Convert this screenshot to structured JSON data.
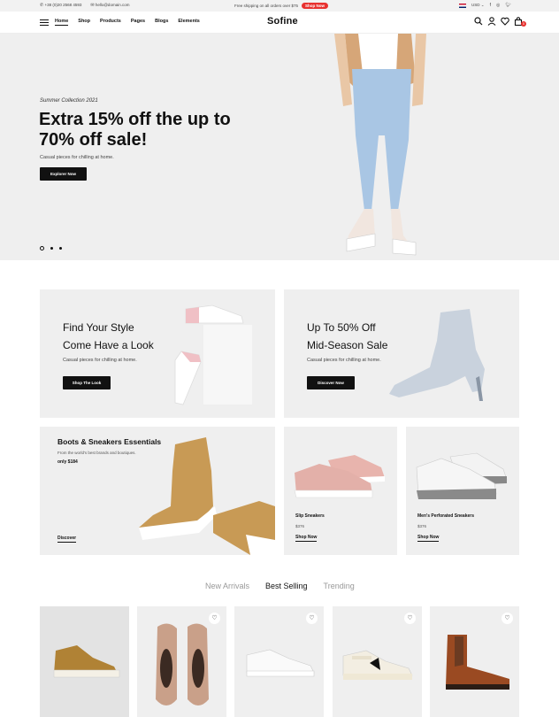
{
  "topbar": {
    "phone": "+38 (0)20 2568 4593",
    "email": "hello@domain.com",
    "shipping_text": "Free shipping on all orders over $75",
    "shipping_button": "Shop Now",
    "currency": "USD"
  },
  "header": {
    "logo": "Sofine",
    "nav": [
      "Home",
      "Shop",
      "Products",
      "Pages",
      "Blogs",
      "Elements"
    ],
    "cart_count": "0"
  },
  "hero": {
    "subtitle": "Summer Collection 2021",
    "headline": "Extra 15% off the up to 70% off sale!",
    "description": "Casual pieces for chilling at home.",
    "button": "Explorer Now"
  },
  "promos": [
    {
      "title_line1": "Find Your Style",
      "title_line2": "Come Have a Look",
      "subtitle": "Casual pieces for chilling at home.",
      "button": "Shop The Look"
    },
    {
      "title_line1": "Up To 50% Off",
      "title_line2": "Mid-Season Sale",
      "subtitle": "Casual pieces for chilling at home.",
      "button": "Discover Now"
    }
  ],
  "boots_card": {
    "title": "Boots & Sneakers Essentials",
    "subtitle": "From the world's best brands and boutiques.",
    "price": "only $184",
    "link": "Discover"
  },
  "small_cards": [
    {
      "name": "Slip Sneakers",
      "price": "$376",
      "link": "Shop Now"
    },
    {
      "name": "Men's Perforated Sneakers",
      "price": "$376",
      "link": "Shop Now"
    }
  ],
  "product_tabs": [
    "New Arrivals",
    "Best Selling",
    "Trending"
  ],
  "colors": {
    "accent": "#e8312f",
    "dark": "#111111",
    "panel": "#efefef"
  }
}
